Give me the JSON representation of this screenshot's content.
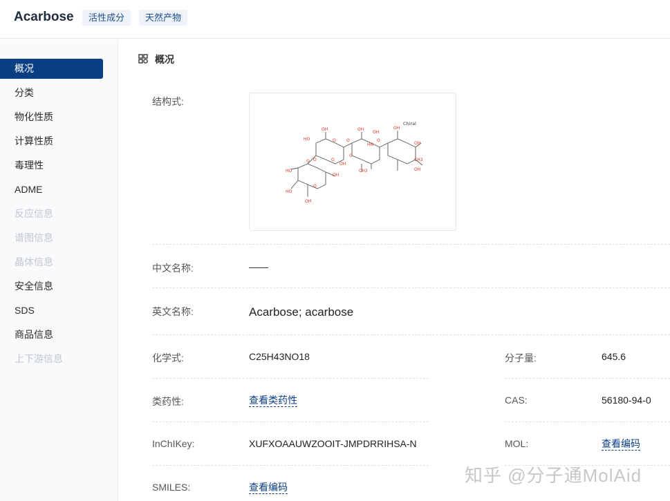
{
  "header": {
    "title": "Acarbose",
    "tags": [
      "活性成分",
      "天然产物"
    ]
  },
  "sidebar": {
    "items": [
      {
        "label": "概况",
        "state": "active"
      },
      {
        "label": "分类",
        "state": "normal"
      },
      {
        "label": "物化性质",
        "state": "normal"
      },
      {
        "label": "计算性质",
        "state": "normal"
      },
      {
        "label": "毒理性",
        "state": "normal"
      },
      {
        "label": "ADME",
        "state": "normal"
      },
      {
        "label": "反应信息",
        "state": "disabled"
      },
      {
        "label": "谱图信息",
        "state": "disabled"
      },
      {
        "label": "晶体信息",
        "state": "disabled"
      },
      {
        "label": "安全信息",
        "state": "normal"
      },
      {
        "label": "SDS",
        "state": "normal"
      },
      {
        "label": "商品信息",
        "state": "normal"
      },
      {
        "label": "上下游信息",
        "state": "disabled"
      }
    ]
  },
  "section": {
    "title": "概况",
    "icon": "grid-icon"
  },
  "fields": {
    "structure": {
      "label": "结构式:"
    },
    "chinese_name": {
      "label": "中文名称:",
      "value": "——"
    },
    "english_name": {
      "label": "英文名称:",
      "value": "Acarbose; acarbose"
    },
    "formula": {
      "label": "化学式:",
      "value": "C25H43NO18"
    },
    "mol_weight": {
      "label": "分子量:",
      "value": "645.6"
    },
    "druglikeness": {
      "label": "类药性:",
      "link": "查看类药性"
    },
    "cas": {
      "label": "CAS:",
      "value": "56180-94-0"
    },
    "inchikey": {
      "label": "InChIKey:",
      "value": "XUFXOAAUWZOOIT-JMPDRRIHSA-N"
    },
    "mol": {
      "label": "MOL:",
      "link": "查看编码"
    },
    "smiles": {
      "label": "SMILES:",
      "link": "查看编码"
    }
  },
  "structure_labels": {
    "chiral": "Chiral",
    "oh": "OH",
    "ho": "HO",
    "o": "O",
    "ch3": "CH3",
    "hn": "HN"
  },
  "colors": {
    "accent": "#0b3f84",
    "tag_bg": "#eef3fa",
    "atom_red": "#e0301e"
  },
  "watermark": "知乎 @分子通MolAid"
}
